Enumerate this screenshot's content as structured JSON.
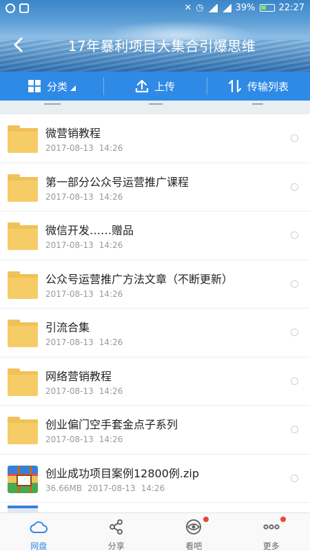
{
  "status_bar": {
    "battery": "39%",
    "time": "22:27"
  },
  "header": {
    "title": "17年暴利项目大集合引爆思维",
    "back_icon": "back-chevron-icon"
  },
  "toolbar": {
    "category_label": "分类",
    "upload_label": "上传",
    "transfer_label": "传输列表"
  },
  "files": [
    {
      "name": "微营销教程",
      "size": "",
      "date": "2017-08-13",
      "time": "14:26",
      "type": "folder"
    },
    {
      "name": "第一部分公众号运营推广课程",
      "size": "",
      "date": "2017-08-13",
      "time": "14:26",
      "type": "folder"
    },
    {
      "name": "微信开发……赠品",
      "size": "",
      "date": "2017-08-13",
      "time": "14:26",
      "type": "folder"
    },
    {
      "name": "公众号运营推广方法文章（不断更新）",
      "size": "",
      "date": "2017-08-13",
      "time": "14:26",
      "type": "folder"
    },
    {
      "name": "引流合集",
      "size": "",
      "date": "2017-08-13",
      "time": "14:26",
      "type": "folder"
    },
    {
      "name": "网络营销教程",
      "size": "",
      "date": "2017-08-13",
      "time": "14:26",
      "type": "folder"
    },
    {
      "name": "创业偏门空手套金点子系列",
      "size": "",
      "date": "2017-08-13",
      "time": "14:26",
      "type": "folder"
    },
    {
      "name": "创业成功项目案例12800例.zip",
      "size": "36.66MB",
      "date": "2017-08-13",
      "time": "14:26",
      "type": "zip"
    }
  ],
  "bottom_nav": [
    {
      "label": "网盘",
      "icon": "cloud-icon",
      "active": true,
      "badge": false
    },
    {
      "label": "分享",
      "icon": "share-icon",
      "active": false,
      "badge": false
    },
    {
      "label": "看吧",
      "icon": "eye-icon",
      "active": false,
      "badge": true
    },
    {
      "label": "更多",
      "icon": "more-icon",
      "active": false,
      "badge": true
    }
  ],
  "colors": {
    "accent": "#2f8ae6",
    "folder": "#f6cc66",
    "badge": "#e9493c"
  }
}
